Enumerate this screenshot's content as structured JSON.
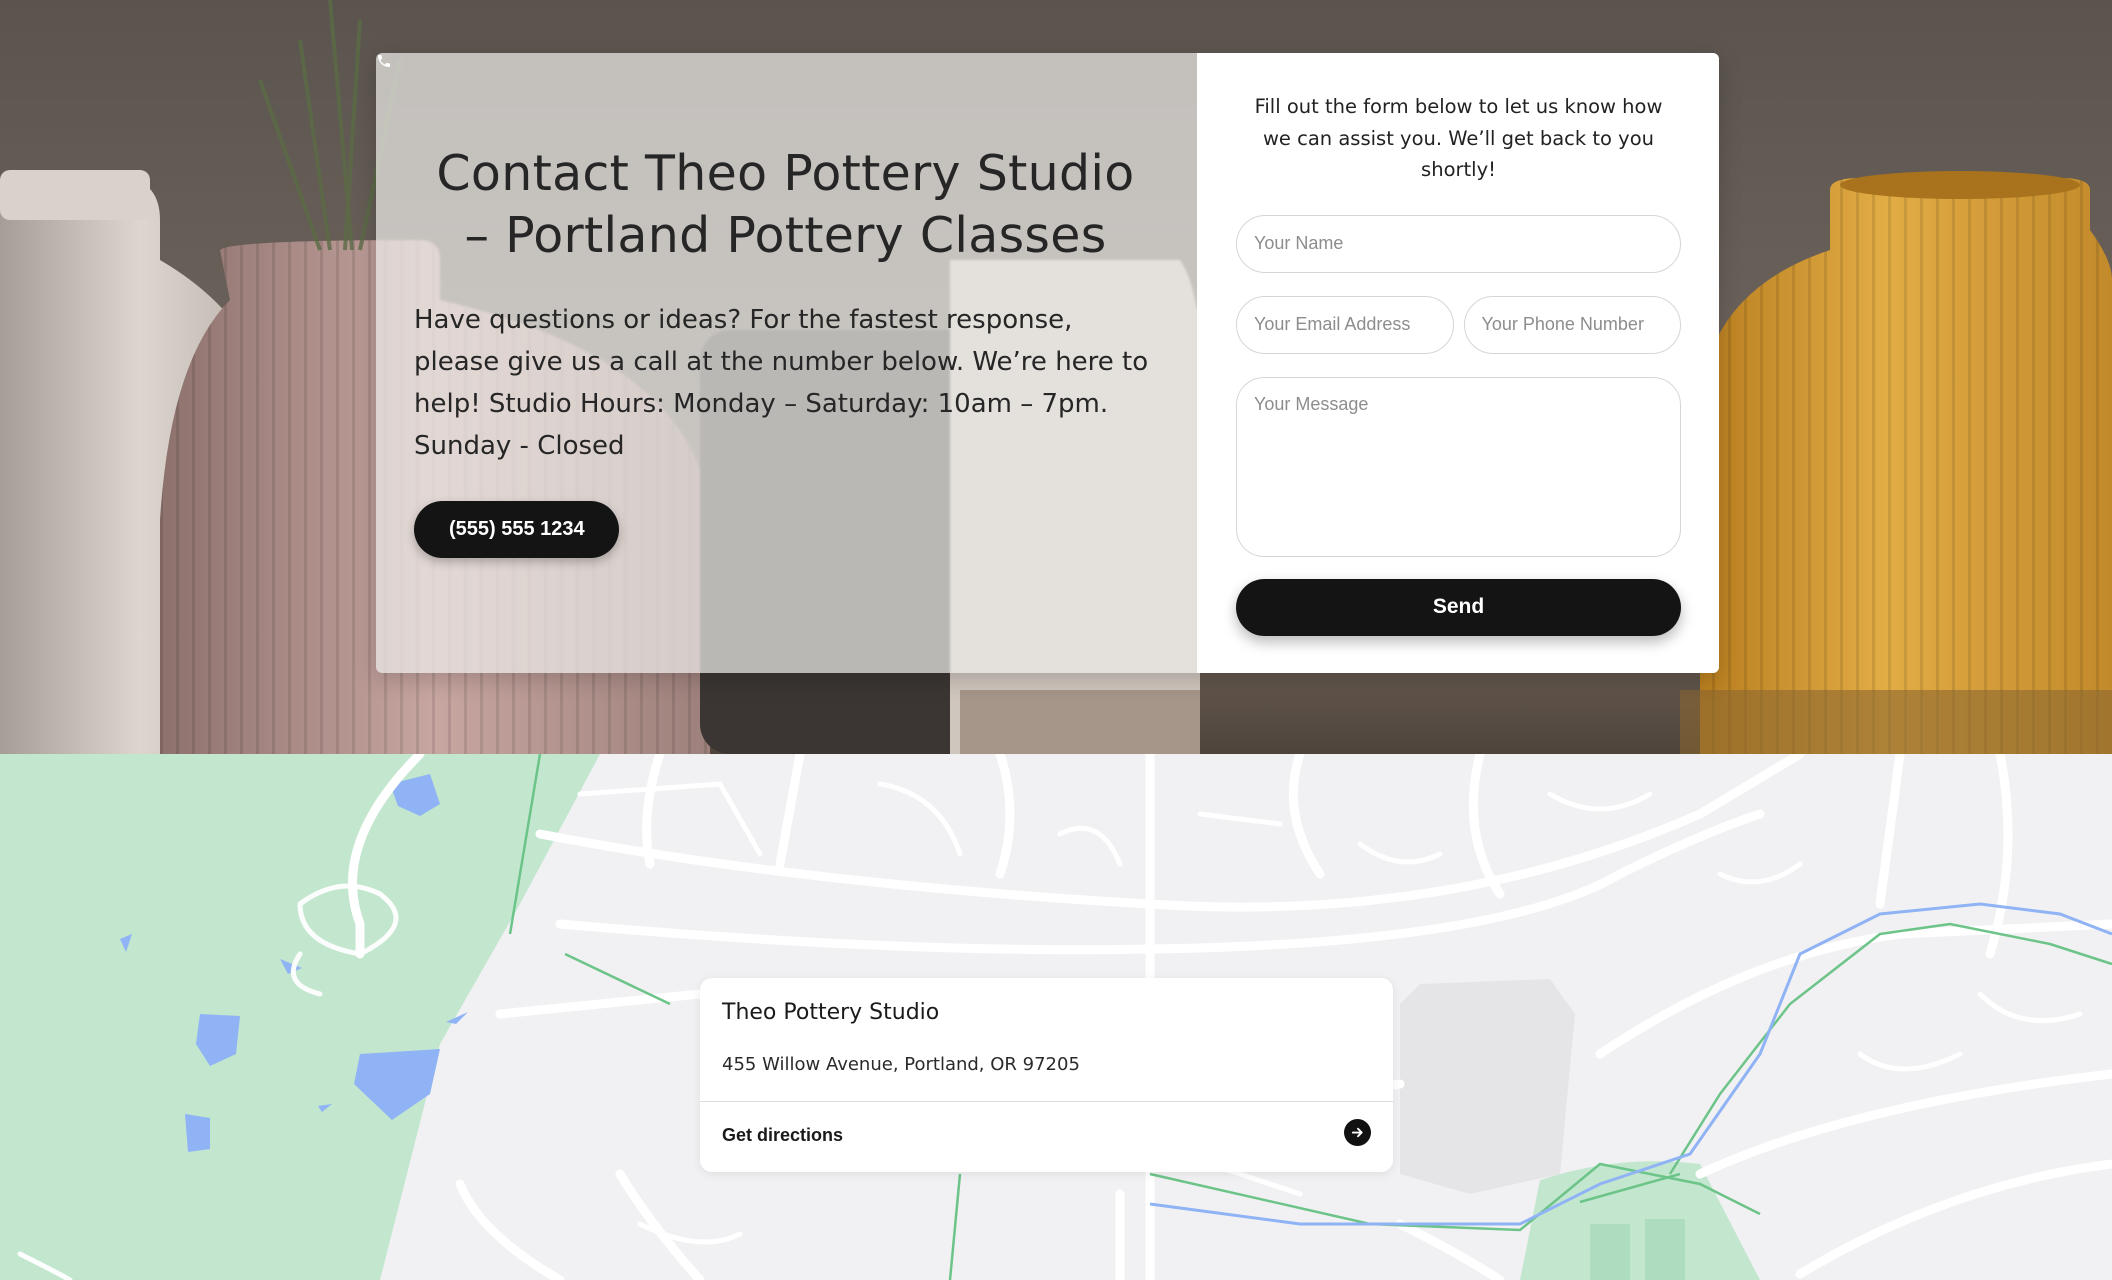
{
  "hero": {
    "title": "Contact Theo Pottery Studio – Portland Pottery Classes",
    "description": "Have questions or ideas? For the fastest response, please give us a call at the number below. We’re here to help! Studio Hours: Monday – Saturday: 10am – 7pm. Sunday - Closed",
    "phone_button": {
      "label": "(555) 555 1234",
      "icon": "phone-icon"
    }
  },
  "form": {
    "intro": "Fill out the form below to let us know how we can assist you. We’ll get back to you shortly!",
    "name_placeholder": "Your Name",
    "email_placeholder": "Your Email Address",
    "phone_placeholder": "Your Phone Number",
    "message_placeholder": "Your Message",
    "send_label": "Send"
  },
  "map_card": {
    "name": "Theo Pottery Studio",
    "address": "455 Willow Avenue, Portland, OR 97205",
    "directions_label": "Get directions",
    "directions_icon": "arrow-right-icon"
  },
  "colors": {
    "button_bg": "#141414",
    "park_green": "#c3e6cf",
    "water_blue": "#8fb3f5",
    "vase_yellow": "#d9a23a",
    "vase_pink": "#c9a9a4"
  }
}
